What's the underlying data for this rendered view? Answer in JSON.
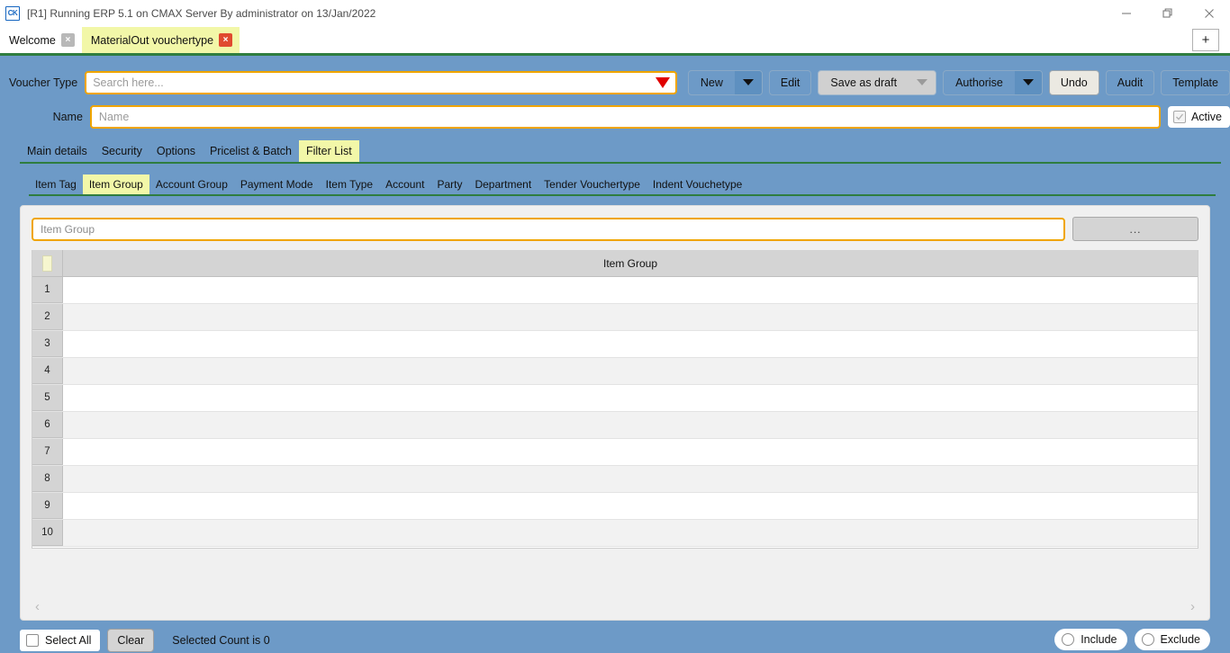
{
  "window": {
    "app_icon_label": "CK",
    "title": "[R1] Running ERP 5.1 on CMAX Server By administrator on 13/Jan/2022",
    "controls": {
      "minimize": "minimize-icon",
      "maximize": "restore-icon",
      "close": "close-icon"
    }
  },
  "tabstrip": {
    "tabs": [
      {
        "label": "Welcome",
        "active": false,
        "close": "×"
      },
      {
        "label": "MaterialOut vouchertype",
        "active": true,
        "close": "×"
      }
    ],
    "new_tab_label": "+"
  },
  "form": {
    "voucher_type_label": "Voucher Type",
    "voucher_type_value": "",
    "voucher_type_placeholder": "Search here...",
    "name_label": "Name",
    "name_value": "",
    "name_placeholder": "Name",
    "active_label": "Active",
    "active_checked": true
  },
  "toolbar": {
    "new_label": "New",
    "edit_label": "Edit",
    "save_as_draft_label": "Save as draft",
    "authorise_label": "Authorise",
    "undo_label": "Undo",
    "audit_label": "Audit",
    "template_label": "Template"
  },
  "primary_tabs": [
    {
      "label": "Main details",
      "active": false
    },
    {
      "label": "Security",
      "active": false
    },
    {
      "label": "Options",
      "active": false
    },
    {
      "label": "Pricelist & Batch",
      "active": false
    },
    {
      "label": "Filter List",
      "active": true
    }
  ],
  "secondary_tabs": [
    {
      "label": "Item Tag",
      "active": false
    },
    {
      "label": "Item Group",
      "active": true
    },
    {
      "label": "Account Group",
      "active": false
    },
    {
      "label": "Payment Mode",
      "active": false
    },
    {
      "label": "Item Type",
      "active": false
    },
    {
      "label": "Account",
      "active": false
    },
    {
      "label": "Party",
      "active": false
    },
    {
      "label": "Department",
      "active": false
    },
    {
      "label": "Tender Vouchertype",
      "active": false
    },
    {
      "label": "Indent Vouchetype",
      "active": false
    }
  ],
  "panel": {
    "filter_input_value": "",
    "filter_input_placeholder": "Item Group",
    "browse_button_label": "...",
    "grid": {
      "column_header": "Item Group",
      "rows": [
        {
          "num": "1",
          "value": ""
        },
        {
          "num": "2",
          "value": ""
        },
        {
          "num": "3",
          "value": ""
        },
        {
          "num": "4",
          "value": ""
        },
        {
          "num": "5",
          "value": ""
        },
        {
          "num": "6",
          "value": ""
        },
        {
          "num": "7",
          "value": ""
        },
        {
          "num": "8",
          "value": ""
        },
        {
          "num": "9",
          "value": ""
        },
        {
          "num": "10",
          "value": ""
        }
      ]
    },
    "scroll_left": "‹",
    "scroll_right": "›"
  },
  "footer": {
    "select_all_label": "Select All",
    "select_all_checked": false,
    "clear_label": "Clear",
    "selected_count_text": "Selected Count is 0",
    "include_label": "Include",
    "include_selected": false,
    "exclude_label": "Exclude",
    "exclude_selected": false
  },
  "colors": {
    "body_blue": "#6d9ac7",
    "accent_yellow": "#f2f7a8",
    "accent_orange": "#f0a500",
    "green_bar": "#2f7d3f",
    "red_arrow": "#e00000",
    "tab_close_red": "#e04a2f"
  }
}
